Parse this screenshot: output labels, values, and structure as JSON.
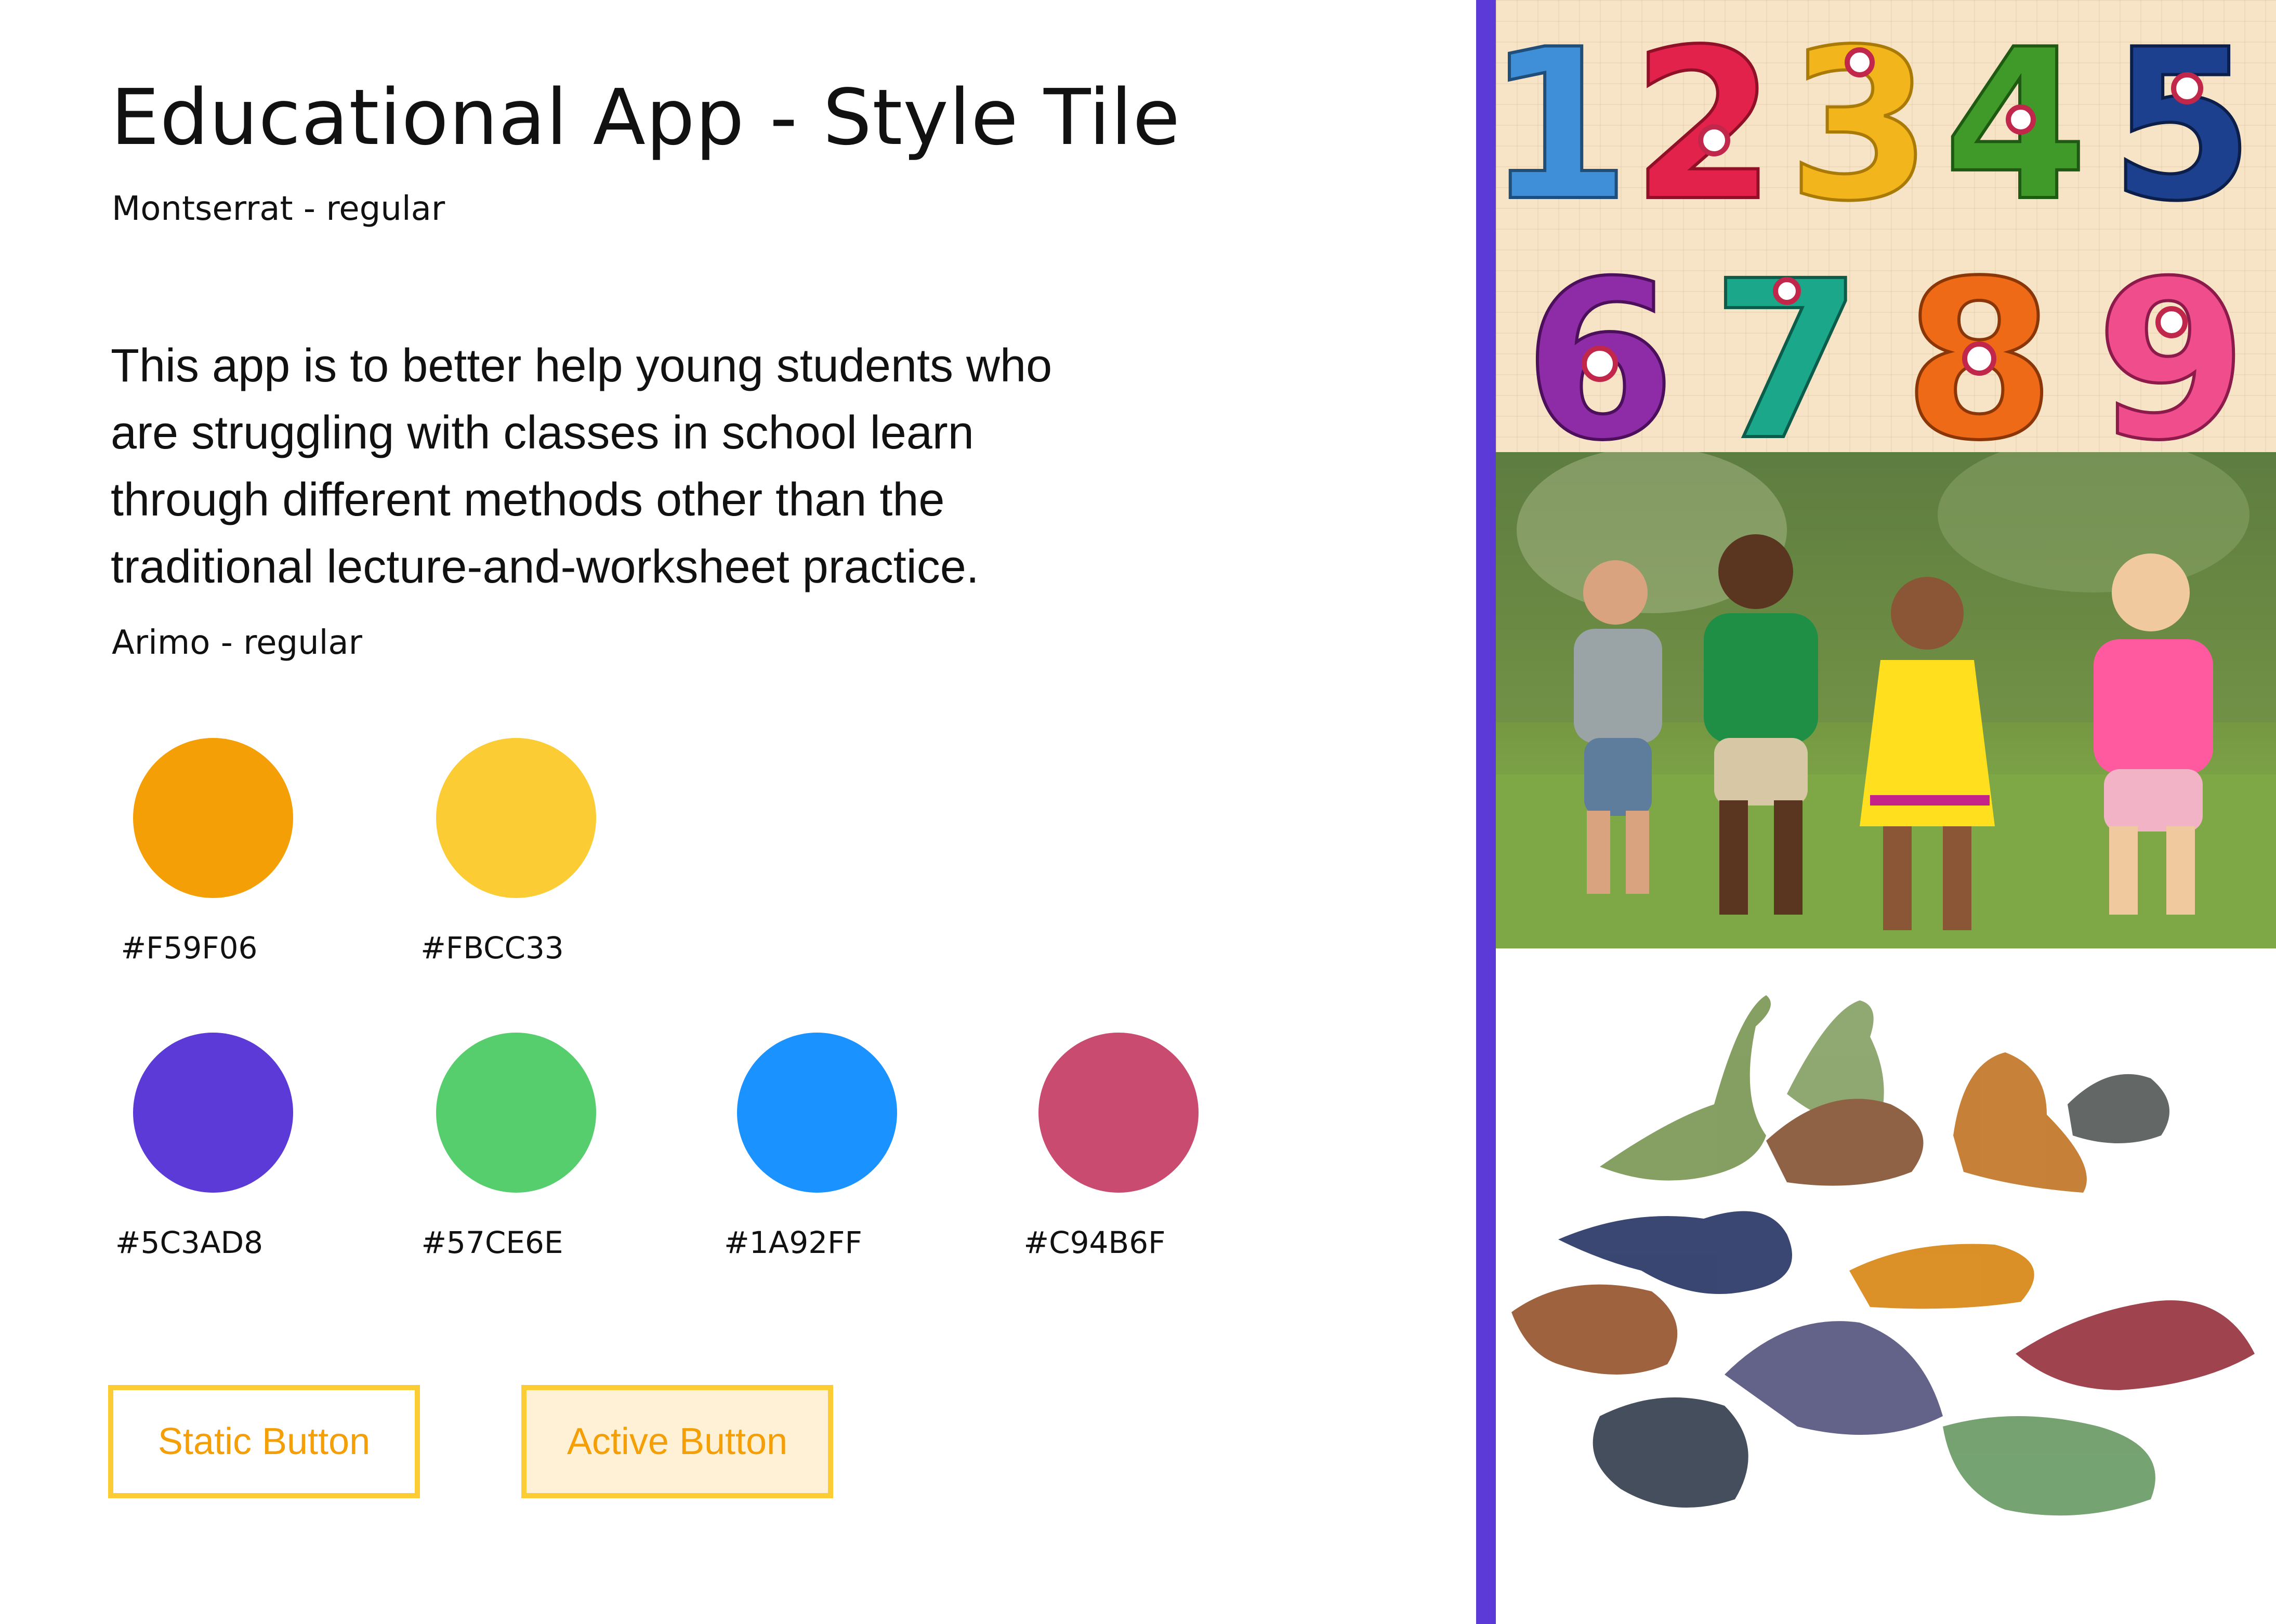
{
  "header": {
    "title": "Educational App - Style Tile",
    "title_font": "Montserrat - regular"
  },
  "body": {
    "copy_lines": [
      "This app is to better help young students who",
      "are struggling with classes in school learn",
      "through different methods other than the",
      "traditional lecture-and-worksheet practice."
    ],
    "copy_font": "Arimo - regular"
  },
  "palette": [
    {
      "hex": "#F59F06",
      "color": "#F59F06"
    },
    {
      "hex": "#FBCC33",
      "color": "#FBCC33"
    },
    {
      "hex": "#5C3AD8",
      "color": "#5C3AD8"
    },
    {
      "hex": "#57CE6E",
      "color": "#57CE6E"
    },
    {
      "hex": "#1A92FF",
      "color": "#1A92FF"
    },
    {
      "hex": "#C94B6F",
      "color": "#C94B6F"
    }
  ],
  "buttons": {
    "static_label": "Static Button",
    "active_label": "Active Button"
  },
  "images": {
    "numbers": {
      "digits_row1": [
        "1",
        "2",
        "3",
        "4",
        "5"
      ],
      "digits_row2": [
        "6",
        "7",
        "8",
        "9"
      ]
    },
    "kids_icon": "children-running-photo",
    "dinos_icon": "toy-dinosaurs-photo"
  },
  "accent_color": "#5C3AD8"
}
